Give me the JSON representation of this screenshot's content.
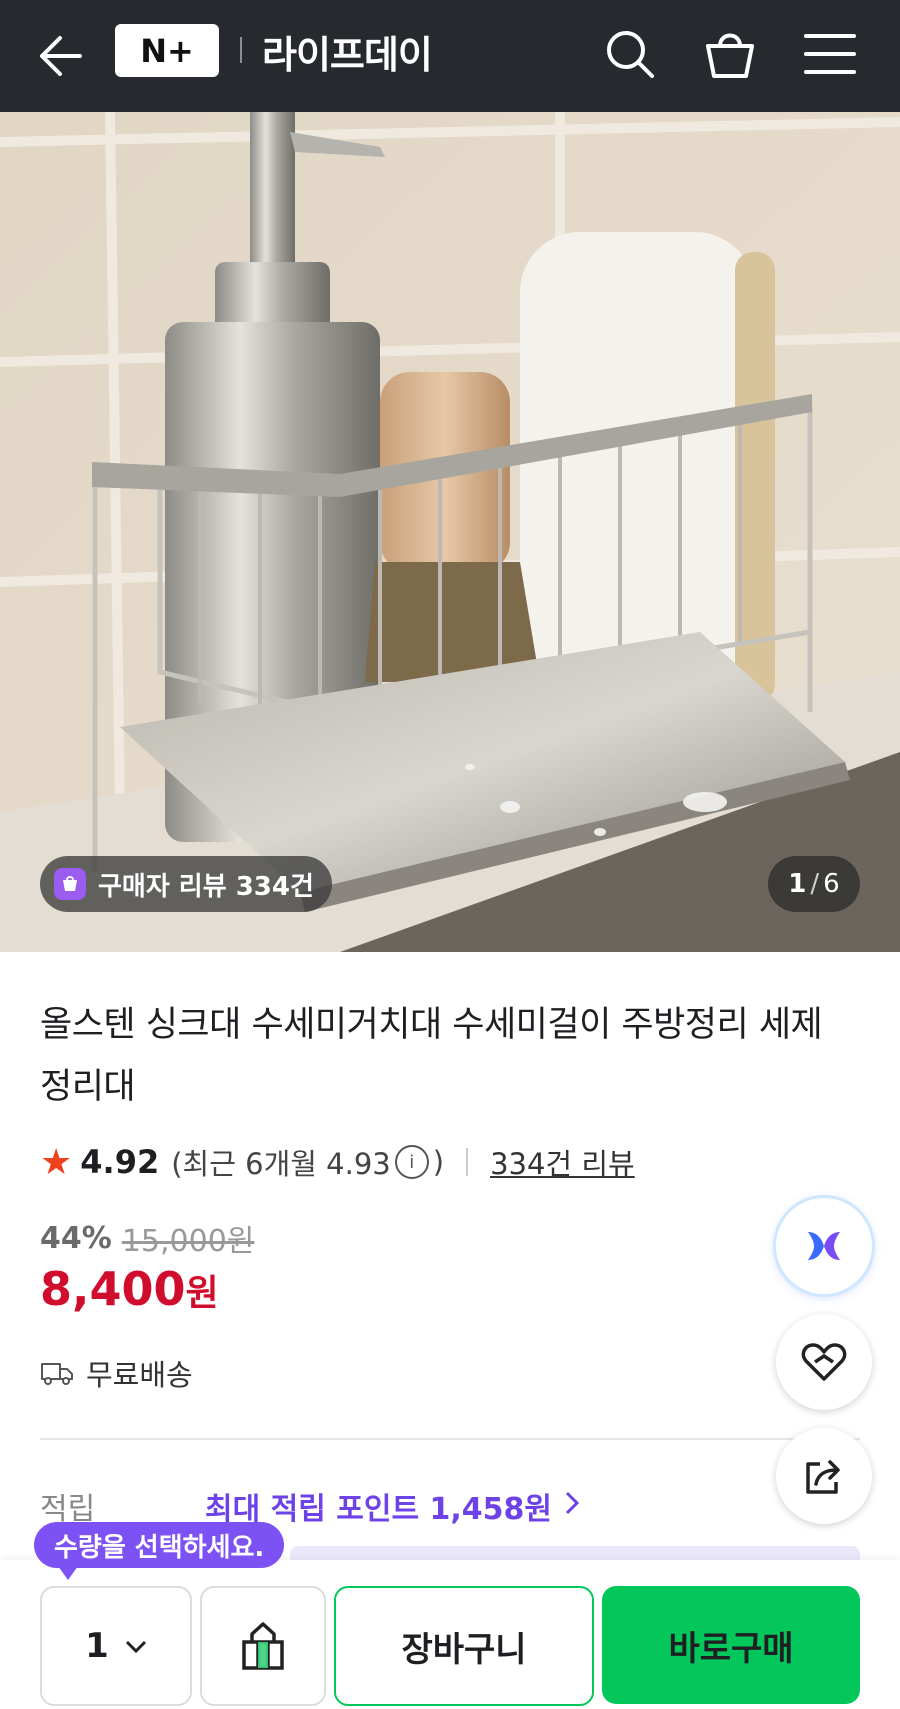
{
  "header": {
    "logo_text": "N+",
    "brand": "라이프데이",
    "icons": [
      "back-arrow-icon",
      "search-icon",
      "shopping-bag-icon",
      "menu-icon"
    ]
  },
  "gallery": {
    "review_chip": "구매자 리뷰 334건",
    "current": "1",
    "separator": "/",
    "total": "6"
  },
  "product": {
    "title": "올스텐 싱크대 수세미거치대 수세미걸이 주방정리 세제 정리대",
    "rating": "4.92",
    "recent_rating_prefix": "(최근 6개월 4.93",
    "recent_rating_suffix": ")",
    "info_glyph": "i",
    "review_link": "334건 리뷰",
    "discount_pct": "44%",
    "original_price": "15,000원",
    "price": "8,400",
    "price_unit": "원",
    "shipping": "무료배송",
    "points_label": "적립",
    "points_value": "최대 적립 포인트 1,458원"
  },
  "tooltip": "수량을 선택하세요.",
  "bottom": {
    "quantity": "1",
    "cart_label": "장바구니",
    "buy_label": "바로구매"
  },
  "colors": {
    "header_bg": "#262a2e",
    "price": "#d00d2d",
    "accent_purple": "#7d52f5",
    "buy_green": "#03c75a",
    "star": "#f0411d"
  }
}
